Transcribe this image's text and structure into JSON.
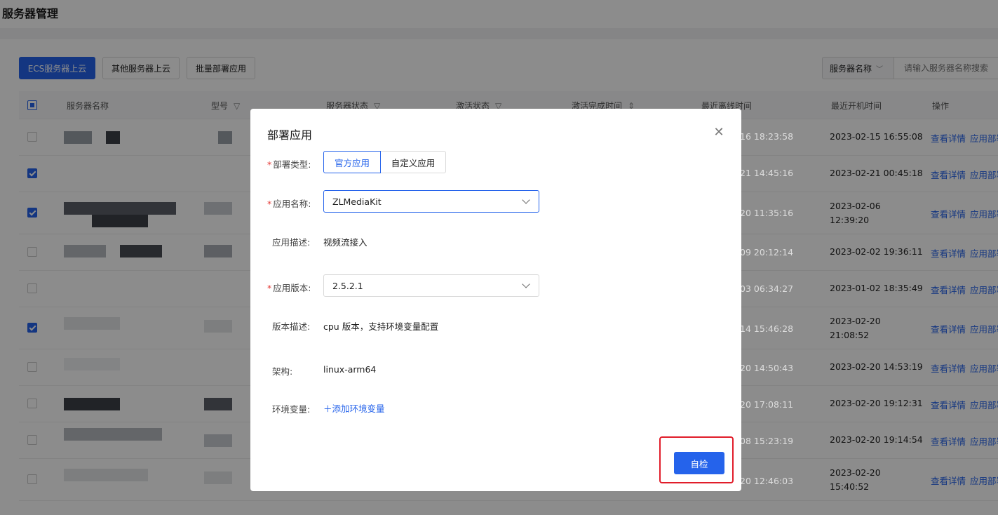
{
  "page": {
    "title": "服务器管理"
  },
  "toolbar": {
    "ecs_label": "ECS服务器上云",
    "other_label": "其他服务器上云",
    "batch_label": "批量部署应用",
    "search_field": "服务器名称",
    "search_placeholder": "请输入服务器名称搜索"
  },
  "table": {
    "columns": [
      "服务器名称",
      "型号",
      "服务器状态",
      "激活状态",
      "激活完成时间",
      "最近离线时间",
      "最近开机时间",
      "操作"
    ],
    "rows": [
      {
        "checked": false,
        "offline_time": "16 18:23:58",
        "boot_time": "2023-02-15 16:55:08"
      },
      {
        "checked": true,
        "offline_time": "21 14:45:16",
        "boot_time": "2023-02-21 00:45:18"
      },
      {
        "checked": true,
        "offline_time": "20 11:35:16",
        "boot_time": "2023-02-06 12:39:20"
      },
      {
        "checked": false,
        "offline_time": "09 20:12:14",
        "boot_time": "2023-02-02 19:36:11"
      },
      {
        "checked": false,
        "offline_time": "03 06:34:27",
        "boot_time": "2023-01-02 18:35:49"
      },
      {
        "checked": true,
        "offline_time": "14 15:46:28",
        "boot_time": "2023-02-20 21:08:52"
      },
      {
        "checked": false,
        "offline_time": "20 14:50:43",
        "boot_time": "2023-02-20 14:53:19"
      },
      {
        "checked": false,
        "offline_time": "20 17:08:11",
        "boot_time": "2023-02-20 19:12:31"
      },
      {
        "checked": false,
        "offline_time": "08 15:23:19",
        "boot_time": "2023-02-20 19:14:54"
      },
      {
        "checked": false,
        "offline_time": "20 12:46:03",
        "boot_time": "2023-02-20 15:40:52"
      }
    ],
    "action_detail": "查看详情",
    "action_deploy": "应用部署"
  },
  "modal": {
    "title": "部署应用",
    "deploy_type_label": "部署类型:",
    "deploy_type_options": [
      "官方应用",
      "自定义应用"
    ],
    "app_name_label": "应用名称:",
    "app_name_value": "ZLMediaKit",
    "app_desc_label": "应用描述:",
    "app_desc_value": "视频流接入",
    "app_version_label": "应用版本:",
    "app_version_value": "2.5.2.1",
    "version_desc_label": "版本描述:",
    "version_desc_value": "cpu 版本，支持环境变量配置",
    "arch_label": "架构:",
    "arch_value": "linux-arm64",
    "env_label": "环境变量:",
    "add_env_label": "添加环境变量",
    "self_check_label": "自检"
  },
  "colors": {
    "primary": "#2563eb",
    "highlight": "#e11d2a",
    "required": "#e53935"
  }
}
